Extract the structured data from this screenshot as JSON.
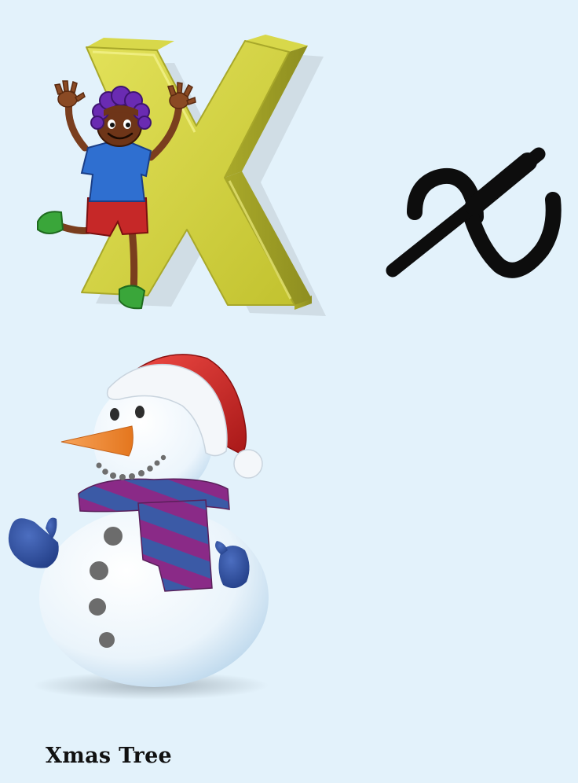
{
  "caption": "Xmas Tree",
  "letters": {
    "uppercase_block": "X",
    "lowercase_script": "x"
  },
  "illustrations": [
    "boy-climbing-letter-x",
    "snowman-with-santa-hat"
  ],
  "colors": {
    "background": "#e3f2fb",
    "block_letter": "#c9c83a",
    "script_letter": "#0d0d0d",
    "hat": "#d92c2c",
    "scarf_purple": "#8a2a87",
    "scarf_blue": "#3b5aa6",
    "mitten": "#2b4a9a",
    "shirt": "#2f6fd0",
    "shorts": "#c62828",
    "hair": "#6a2bb2",
    "shoes": "#3aa63a",
    "carrot": "#f08a2a",
    "caption_text": "#111111"
  }
}
